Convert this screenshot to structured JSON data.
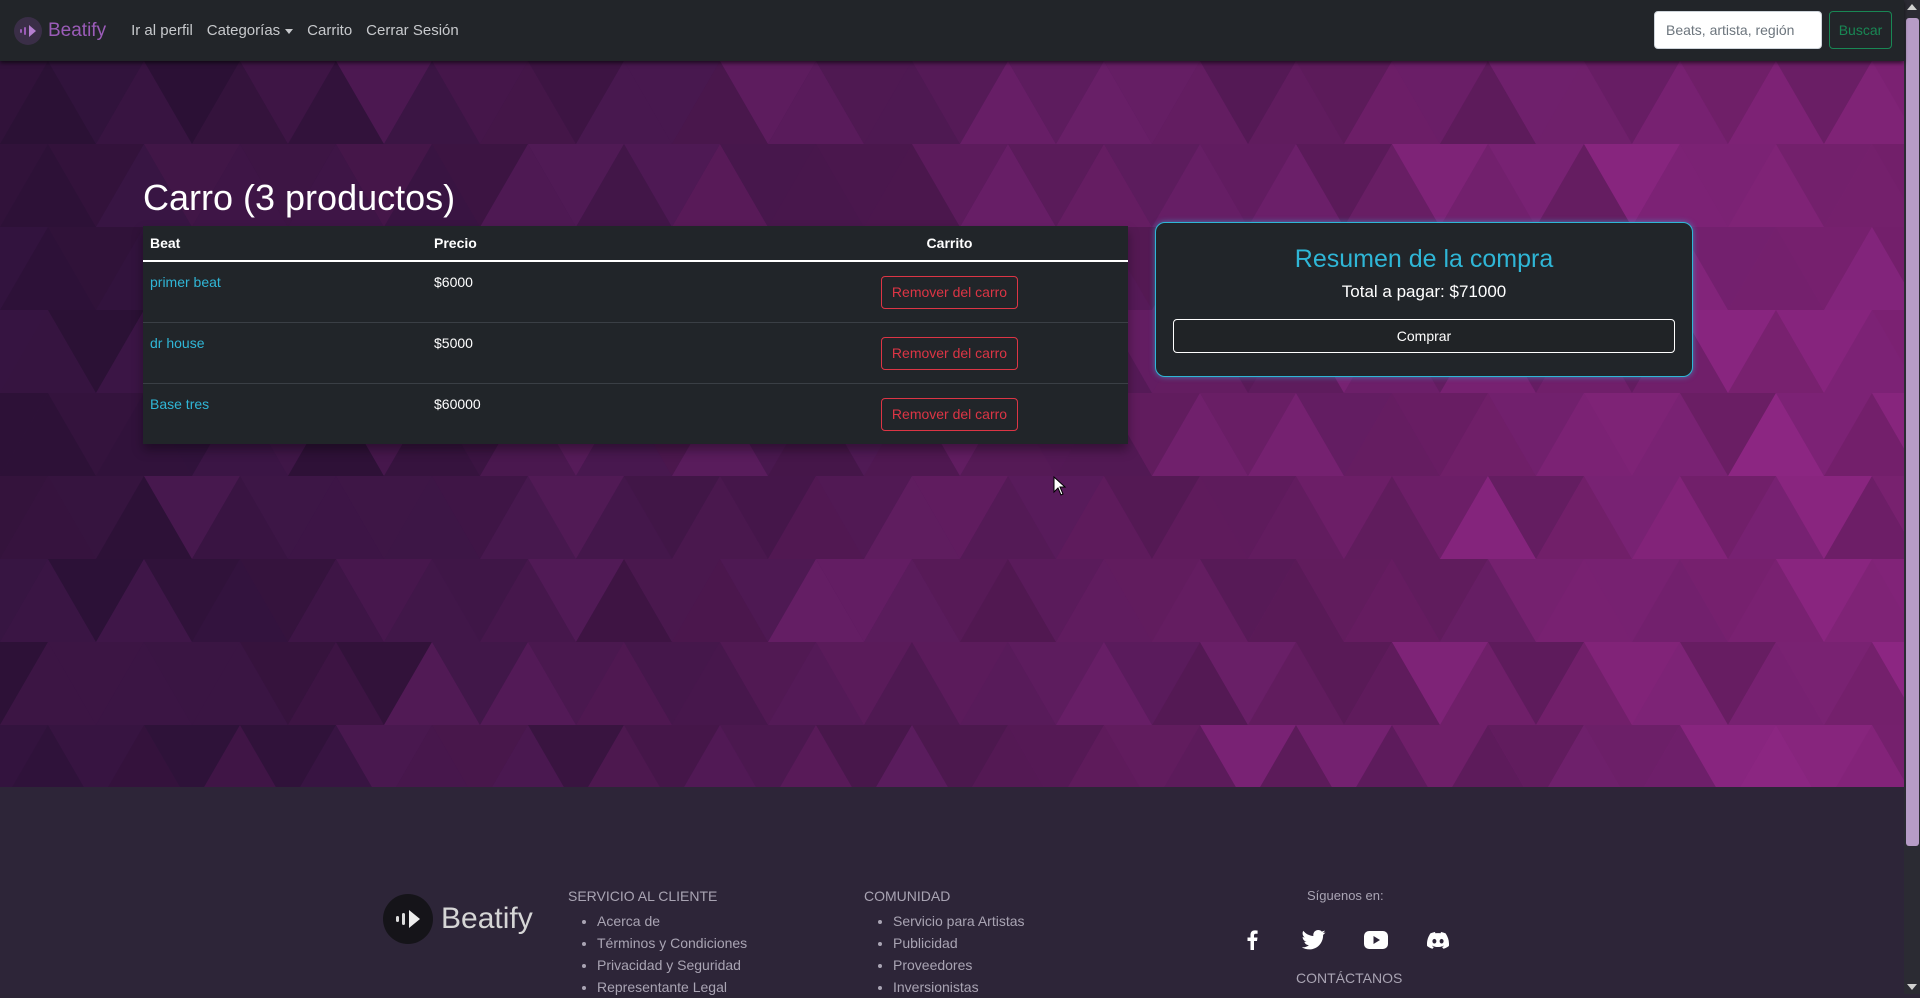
{
  "navbar": {
    "brand": "Beatify",
    "links": [
      {
        "label": "Ir al perfil"
      },
      {
        "label": "Categorías"
      },
      {
        "label": "Carrito"
      },
      {
        "label": "Cerrar Sesión"
      }
    ],
    "search_placeholder": "Beats, artista, región",
    "search_button": "Buscar"
  },
  "cart": {
    "title": "Carro (3 productos)",
    "columns": [
      "Beat",
      "Precio",
      "Carrito"
    ],
    "rows": [
      {
        "beat": "primer beat",
        "price": "$6000",
        "action": "Remover del carro"
      },
      {
        "beat": "dr house",
        "price": "$5000",
        "action": "Remover del carro"
      },
      {
        "beat": "Base tres",
        "price": "$60000",
        "action": "Remover del carro"
      }
    ]
  },
  "summary": {
    "title": "Resumen de la compra",
    "total": "Total a pagar: $71000",
    "buy_button": "Comprar"
  },
  "footer": {
    "brand": "Beatify",
    "customer_service": {
      "title": "SERVICIO AL CLIENTE",
      "items": [
        "Acerca de",
        "Términos y Condiciones",
        "Privacidad y Seguridad",
        "Representante Legal"
      ]
    },
    "community": {
      "title": "COMUNIDAD",
      "items": [
        "Servicio para Artistas",
        "Publicidad",
        "Proveedores",
        "Inversionistas"
      ]
    },
    "follow_title": "Síguenos en:",
    "social_icons": [
      "facebook-icon",
      "twitter-icon",
      "youtube-icon",
      "discord-icon"
    ],
    "contact_title": "CONTÁCTANOS"
  },
  "colors": {
    "accent": "#2fb6d6",
    "danger": "#dc3545",
    "success": "#198754",
    "brand": "#9b5cb8"
  }
}
